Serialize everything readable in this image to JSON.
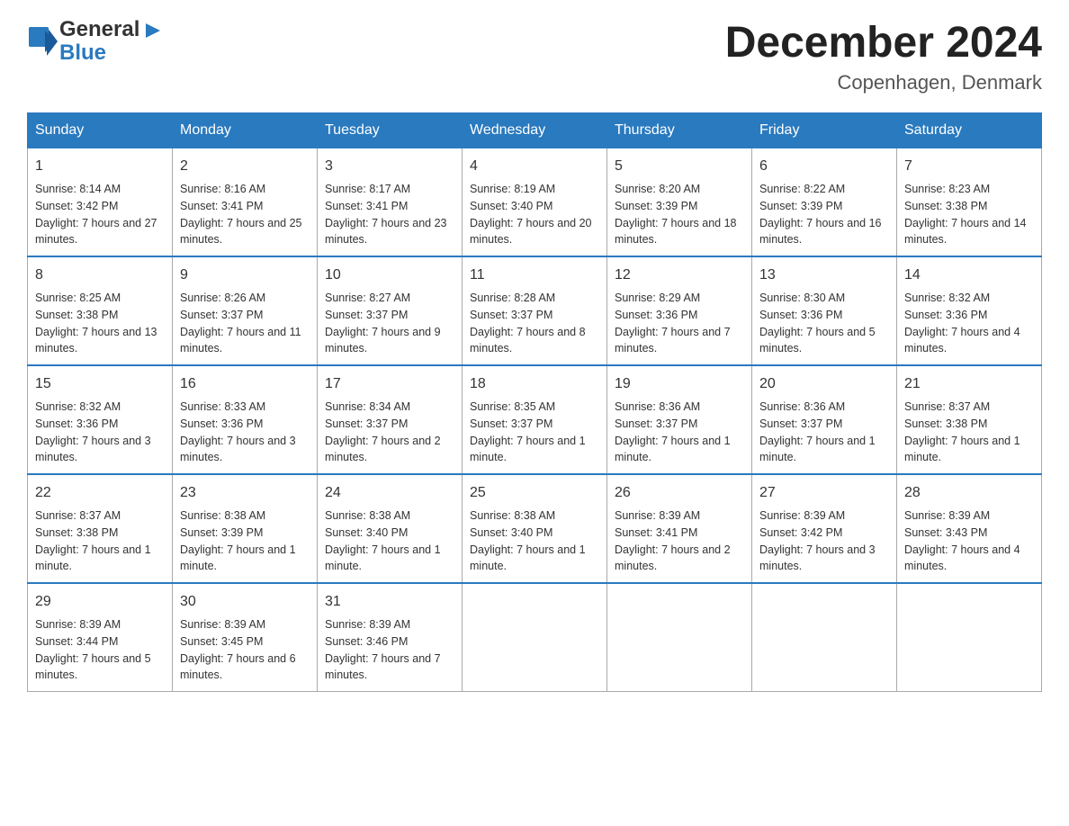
{
  "header": {
    "logo_general": "General",
    "logo_blue": "Blue",
    "title": "December 2024",
    "subtitle": "Copenhagen, Denmark"
  },
  "calendar": {
    "days_of_week": [
      "Sunday",
      "Monday",
      "Tuesday",
      "Wednesday",
      "Thursday",
      "Friday",
      "Saturday"
    ],
    "weeks": [
      [
        {
          "date": "1",
          "sunrise": "8:14 AM",
          "sunset": "3:42 PM",
          "daylight": "7 hours and 27 minutes."
        },
        {
          "date": "2",
          "sunrise": "8:16 AM",
          "sunset": "3:41 PM",
          "daylight": "7 hours and 25 minutes."
        },
        {
          "date": "3",
          "sunrise": "8:17 AM",
          "sunset": "3:41 PM",
          "daylight": "7 hours and 23 minutes."
        },
        {
          "date": "4",
          "sunrise": "8:19 AM",
          "sunset": "3:40 PM",
          "daylight": "7 hours and 20 minutes."
        },
        {
          "date": "5",
          "sunrise": "8:20 AM",
          "sunset": "3:39 PM",
          "daylight": "7 hours and 18 minutes."
        },
        {
          "date": "6",
          "sunrise": "8:22 AM",
          "sunset": "3:39 PM",
          "daylight": "7 hours and 16 minutes."
        },
        {
          "date": "7",
          "sunrise": "8:23 AM",
          "sunset": "3:38 PM",
          "daylight": "7 hours and 14 minutes."
        }
      ],
      [
        {
          "date": "8",
          "sunrise": "8:25 AM",
          "sunset": "3:38 PM",
          "daylight": "7 hours and 13 minutes."
        },
        {
          "date": "9",
          "sunrise": "8:26 AM",
          "sunset": "3:37 PM",
          "daylight": "7 hours and 11 minutes."
        },
        {
          "date": "10",
          "sunrise": "8:27 AM",
          "sunset": "3:37 PM",
          "daylight": "7 hours and 9 minutes."
        },
        {
          "date": "11",
          "sunrise": "8:28 AM",
          "sunset": "3:37 PM",
          "daylight": "7 hours and 8 minutes."
        },
        {
          "date": "12",
          "sunrise": "8:29 AM",
          "sunset": "3:36 PM",
          "daylight": "7 hours and 7 minutes."
        },
        {
          "date": "13",
          "sunrise": "8:30 AM",
          "sunset": "3:36 PM",
          "daylight": "7 hours and 5 minutes."
        },
        {
          "date": "14",
          "sunrise": "8:32 AM",
          "sunset": "3:36 PM",
          "daylight": "7 hours and 4 minutes."
        }
      ],
      [
        {
          "date": "15",
          "sunrise": "8:32 AM",
          "sunset": "3:36 PM",
          "daylight": "7 hours and 3 minutes."
        },
        {
          "date": "16",
          "sunrise": "8:33 AM",
          "sunset": "3:36 PM",
          "daylight": "7 hours and 3 minutes."
        },
        {
          "date": "17",
          "sunrise": "8:34 AM",
          "sunset": "3:37 PM",
          "daylight": "7 hours and 2 minutes."
        },
        {
          "date": "18",
          "sunrise": "8:35 AM",
          "sunset": "3:37 PM",
          "daylight": "7 hours and 1 minute."
        },
        {
          "date": "19",
          "sunrise": "8:36 AM",
          "sunset": "3:37 PM",
          "daylight": "7 hours and 1 minute."
        },
        {
          "date": "20",
          "sunrise": "8:36 AM",
          "sunset": "3:37 PM",
          "daylight": "7 hours and 1 minute."
        },
        {
          "date": "21",
          "sunrise": "8:37 AM",
          "sunset": "3:38 PM",
          "daylight": "7 hours and 1 minute."
        }
      ],
      [
        {
          "date": "22",
          "sunrise": "8:37 AM",
          "sunset": "3:38 PM",
          "daylight": "7 hours and 1 minute."
        },
        {
          "date": "23",
          "sunrise": "8:38 AM",
          "sunset": "3:39 PM",
          "daylight": "7 hours and 1 minute."
        },
        {
          "date": "24",
          "sunrise": "8:38 AM",
          "sunset": "3:40 PM",
          "daylight": "7 hours and 1 minute."
        },
        {
          "date": "25",
          "sunrise": "8:38 AM",
          "sunset": "3:40 PM",
          "daylight": "7 hours and 1 minute."
        },
        {
          "date": "26",
          "sunrise": "8:39 AM",
          "sunset": "3:41 PM",
          "daylight": "7 hours and 2 minutes."
        },
        {
          "date": "27",
          "sunrise": "8:39 AM",
          "sunset": "3:42 PM",
          "daylight": "7 hours and 3 minutes."
        },
        {
          "date": "28",
          "sunrise": "8:39 AM",
          "sunset": "3:43 PM",
          "daylight": "7 hours and 4 minutes."
        }
      ],
      [
        {
          "date": "29",
          "sunrise": "8:39 AM",
          "sunset": "3:44 PM",
          "daylight": "7 hours and 5 minutes."
        },
        {
          "date": "30",
          "sunrise": "8:39 AM",
          "sunset": "3:45 PM",
          "daylight": "7 hours and 6 minutes."
        },
        {
          "date": "31",
          "sunrise": "8:39 AM",
          "sunset": "3:46 PM",
          "daylight": "7 hours and 7 minutes."
        },
        null,
        null,
        null,
        null
      ]
    ]
  }
}
